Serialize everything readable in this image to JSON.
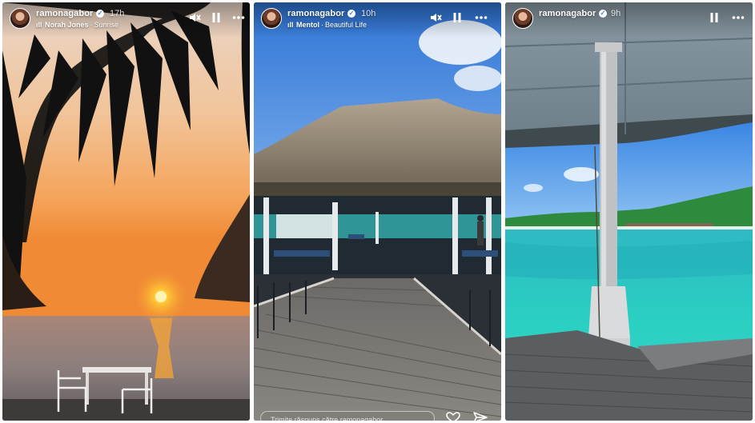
{
  "stories": [
    {
      "username": "ramonagabor",
      "time": "17h",
      "music": {
        "artist": "Norah Jones",
        "track": "Sunrise"
      },
      "controls": [
        "mute-icon",
        "pause-icon",
        "more-icon"
      ]
    },
    {
      "username": "ramonagabor",
      "time": "10h",
      "music": {
        "artist": "Mentol",
        "track": "Beautiful Life"
      },
      "controls": [
        "mute-icon",
        "pause-icon",
        "more-icon"
      ],
      "reply_placeholder": "Trimite răspuns către ramonagabor...",
      "footer_icons": [
        "heart-icon",
        "send-icon"
      ]
    },
    {
      "username": "ramonagabor",
      "time": "9h",
      "controls": [
        "pause-icon",
        "more-icon"
      ]
    }
  ],
  "colors": {
    "text": "#ffffff",
    "verified_badge": "#3b7dd8",
    "sunset_sky_top": "#f2b77f",
    "sunset_sun": "#ffb020",
    "tropical_water": "#28c2b8",
    "sky_blue": "#4a93e6"
  }
}
